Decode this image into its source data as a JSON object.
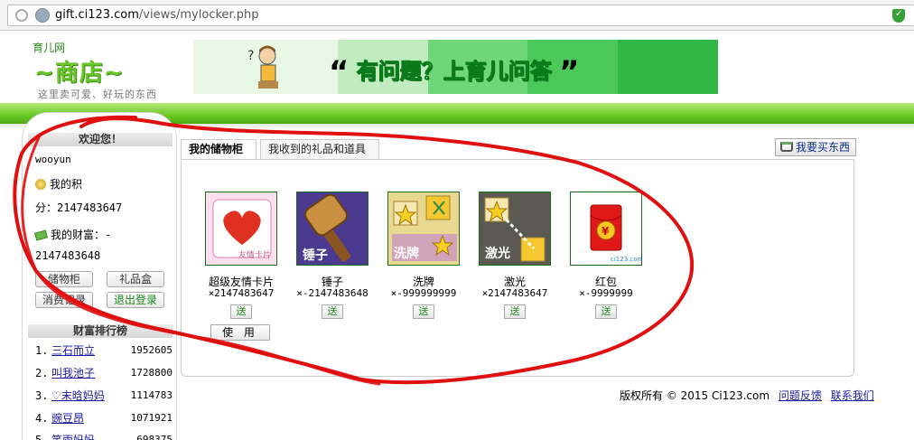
{
  "browser": {
    "url_domain": "gift.ci123.com",
    "url_path": "/views/mylocker.php"
  },
  "header": {
    "logo_small": "育儿网",
    "logo_big": "~商店~",
    "logo_sub": "这里卖可爱、好玩的东西",
    "banner_text": "有问题？上育儿问答"
  },
  "sidebar": {
    "welcome": "欢迎您！",
    "username": "wooyun",
    "points_label": "我的积",
    "points_value": "分：2147483647",
    "wealth_label": "我的财富：-",
    "wealth_value": "2147483648",
    "buttons": {
      "locker": "储物柜",
      "giftbox": "礼品盒",
      "spending": "消费记录",
      "logout": "退出登录"
    },
    "ranking_title": "财富排行榜",
    "ranking": [
      {
        "num": "1.",
        "name": "三石而立",
        "score": "1952605"
      },
      {
        "num": "2.",
        "name": "叫我池子",
        "score": "1728800"
      },
      {
        "num": "3.",
        "name": "♡末晗妈妈",
        "score": "1114783"
      },
      {
        "num": "4.",
        "name": "豌豆昂",
        "score": "1071921"
      },
      {
        "num": "5.",
        "name": "笑雨妈妈",
        "score": "698375"
      }
    ]
  },
  "tabs": [
    {
      "label": "我的储物柜"
    },
    {
      "label": "我收到的礼品和道具"
    }
  ],
  "buy_button": "我要买东西",
  "items": [
    {
      "name": "超级友情卡片",
      "count": "×2147483647",
      "send": "送",
      "use": "使 用",
      "caption": "友情卡片"
    },
    {
      "name": "锤子",
      "count": "×-2147483648",
      "send": "送",
      "caption": "锤子"
    },
    {
      "name": "洗牌",
      "count": "×-999999999",
      "send": "送",
      "caption": "洗牌"
    },
    {
      "name": "激光",
      "count": "×2147483647",
      "send": "送",
      "caption": "激光"
    },
    {
      "name": "红包",
      "count": "×-9999999",
      "send": "送",
      "caption": "ci123.com"
    }
  ],
  "footer": {
    "copyright": "版权所有 © 2015 Ci123.com",
    "feedback": "问题反馈",
    "contact": "联系我们"
  },
  "colors": {
    "brand_green": "#69c823",
    "link_blue": "#1a1aa0",
    "annotation_red": "#e01010"
  }
}
